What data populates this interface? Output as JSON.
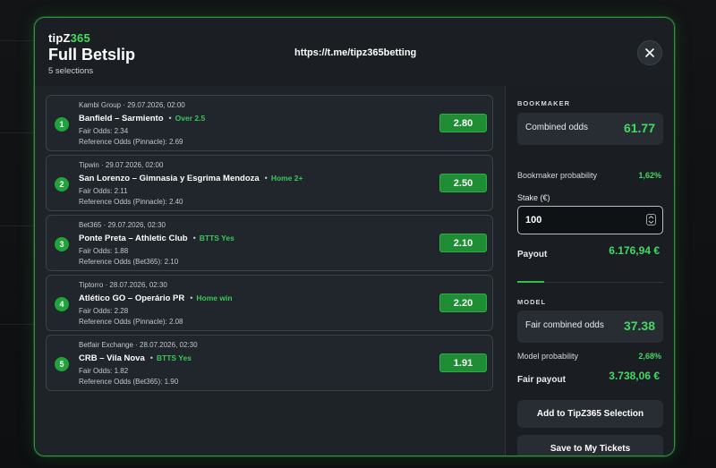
{
  "header": {
    "brand_prefix": "tipZ",
    "brand_accent": "365",
    "title": "Full Betslip",
    "subtitle": "5 selections",
    "link": "https://t.me/tipz365betting",
    "close_icon": "close-icon"
  },
  "bets": [
    {
      "num": "1",
      "meta": "Kambi Group · 29.07.2026, 02:00",
      "match": "Banfield – Sarmiento",
      "pick": "Over 2.5",
      "fair": "Fair Odds: 2.34",
      "ref": "Reference Odds (Pinnacle): 2.69",
      "odds": "2.80"
    },
    {
      "num": "2",
      "meta": "Tipwin · 29.07.2026, 02:00",
      "match": "San Lorenzo – Gimnasia y Esgrima Mendoza",
      "pick": "Home 2+",
      "fair": "Fair Odds: 2.11",
      "ref": "Reference Odds (Pinnacle): 2.40",
      "odds": "2.50"
    },
    {
      "num": "3",
      "meta": "Bet365 · 29.07.2026, 02:30",
      "match": "Ponte Preta – Athletic Club",
      "pick": "BTTS Yes",
      "fair": "Fair Odds: 1.88",
      "ref": "Reference Odds (Bet365): 2.10",
      "odds": "2.10"
    },
    {
      "num": "4",
      "meta": "Tiptorro · 28.07.2026, 02:30",
      "match": "Atlético GO – Operário PR",
      "pick": "Home win",
      "fair": "Fair Odds: 2.28",
      "ref": "Reference Odds (Pinnacle): 2.08",
      "odds": "2.20"
    },
    {
      "num": "5",
      "meta": "Betfair Exchange · 28.07.2026, 02:30",
      "match": "CRB – Vila Nova",
      "pick": "BTTS Yes",
      "fair": "Fair Odds: 1.82",
      "ref": "Reference Odds (Bet365): 1.90",
      "odds": "1.91"
    }
  ],
  "bookmaker": {
    "section": "BOOKMAKER",
    "combined_label": "Combined odds",
    "combined_value": "61.77",
    "prob_label": "Bookmaker probability",
    "prob_value": "1,62%",
    "stake_label": "Stake (€)",
    "stake_value": "100",
    "payout_label": "Payout",
    "payout_value": "6.176,94 €"
  },
  "model": {
    "section": "MODEL",
    "combined_label": "Fair combined odds",
    "combined_value": "37.38",
    "prob_label": "Model probability",
    "prob_value": "2,68%",
    "payout_label": "Fair payout",
    "payout_value": "3.738,06 €"
  },
  "actions": {
    "add_label": "Add to TipZ365 Selection",
    "save_label": "Save to My Tickets"
  },
  "colors": {
    "accent": "#3fe05a",
    "odds_button": "#1f8d34",
    "modal_border": "#2f8f3a"
  }
}
